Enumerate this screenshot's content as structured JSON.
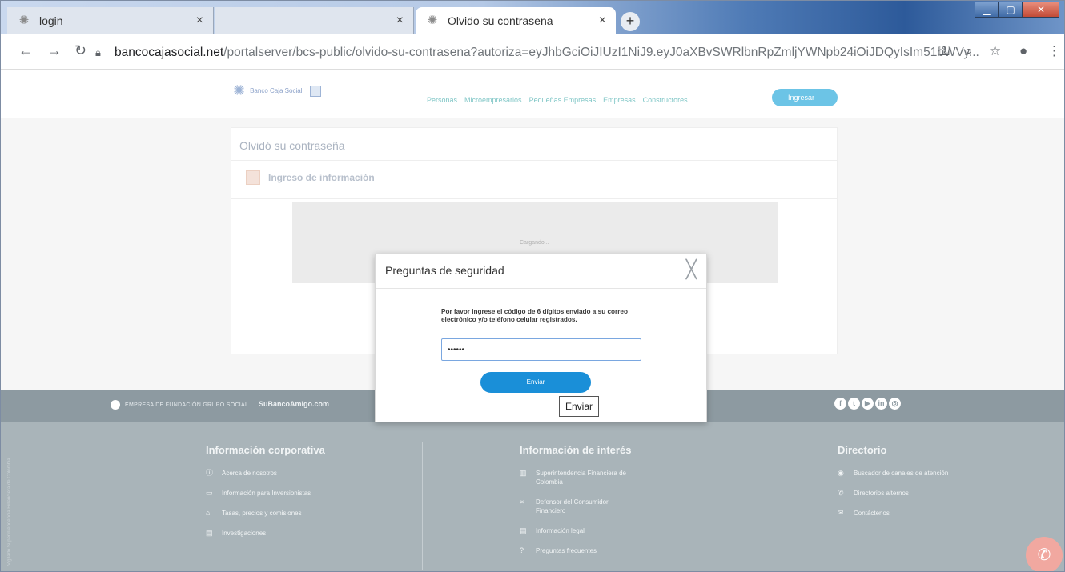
{
  "browser": {
    "tabs": [
      {
        "title": "login",
        "close": "×"
      },
      {
        "title": "",
        "close": "×"
      },
      {
        "title": "Olvido su contrasena",
        "close": "×"
      }
    ],
    "new_tab": "+",
    "url_domain": "bancocajasocial.net",
    "url_path": "/portalserver/bcs-public/olvido-su-contrasena?autoriza=eyJhbGciOiJIUzI1NiJ9.eyJ0aXBvSWRlbnRpZmljYWNpb24iOiJDQyIsIm51bWVy..."
  },
  "site": {
    "logo_text": "Banco Caja Social",
    "nav": [
      "Personas",
      "Microempresarios",
      "Pequeñas Empresas",
      "Empresas",
      "Constructores"
    ],
    "ingresar": "Ingresar"
  },
  "card": {
    "title": "Olvidó su contraseña",
    "subtitle": "Ingreso de información",
    "loading": "Cargando..."
  },
  "modal": {
    "title": "Preguntas de seguridad",
    "close": "╳",
    "text": "Por favor ingrese el código de 6 dígitos enviado a su correo electrónico y/o teléfono celular registrados.",
    "code_value": "••••••",
    "submit": "Enviar",
    "tooltip": "Enviar"
  },
  "footer_bar": {
    "left": "EMPRESA DE  FUNDACIÓN GRUPO SOCIAL",
    "amigo": "SuBancoAmigo.com",
    "social": [
      "f",
      "t",
      "▶",
      "in",
      "◎"
    ]
  },
  "footer": {
    "side_text": "Vigilado Superintendencia Financiera de Colombia",
    "col1": {
      "title": "Información corporativa",
      "items": [
        "Acerca de nosotros",
        "Información para Inversionistas",
        "Tasas, precios y comisiones",
        "Investigaciones"
      ]
    },
    "col2": {
      "title": "Información de interés",
      "items": [
        "Superintendencia Financiera de Colombia",
        "Defensor del Consumidor Financiero",
        "Información legal",
        "Preguntas frecuentes"
      ]
    },
    "col3": {
      "title": "Directorio",
      "items": [
        "Buscador de canales de atención",
        "Directorios alternos",
        "Contáctenos"
      ]
    }
  }
}
